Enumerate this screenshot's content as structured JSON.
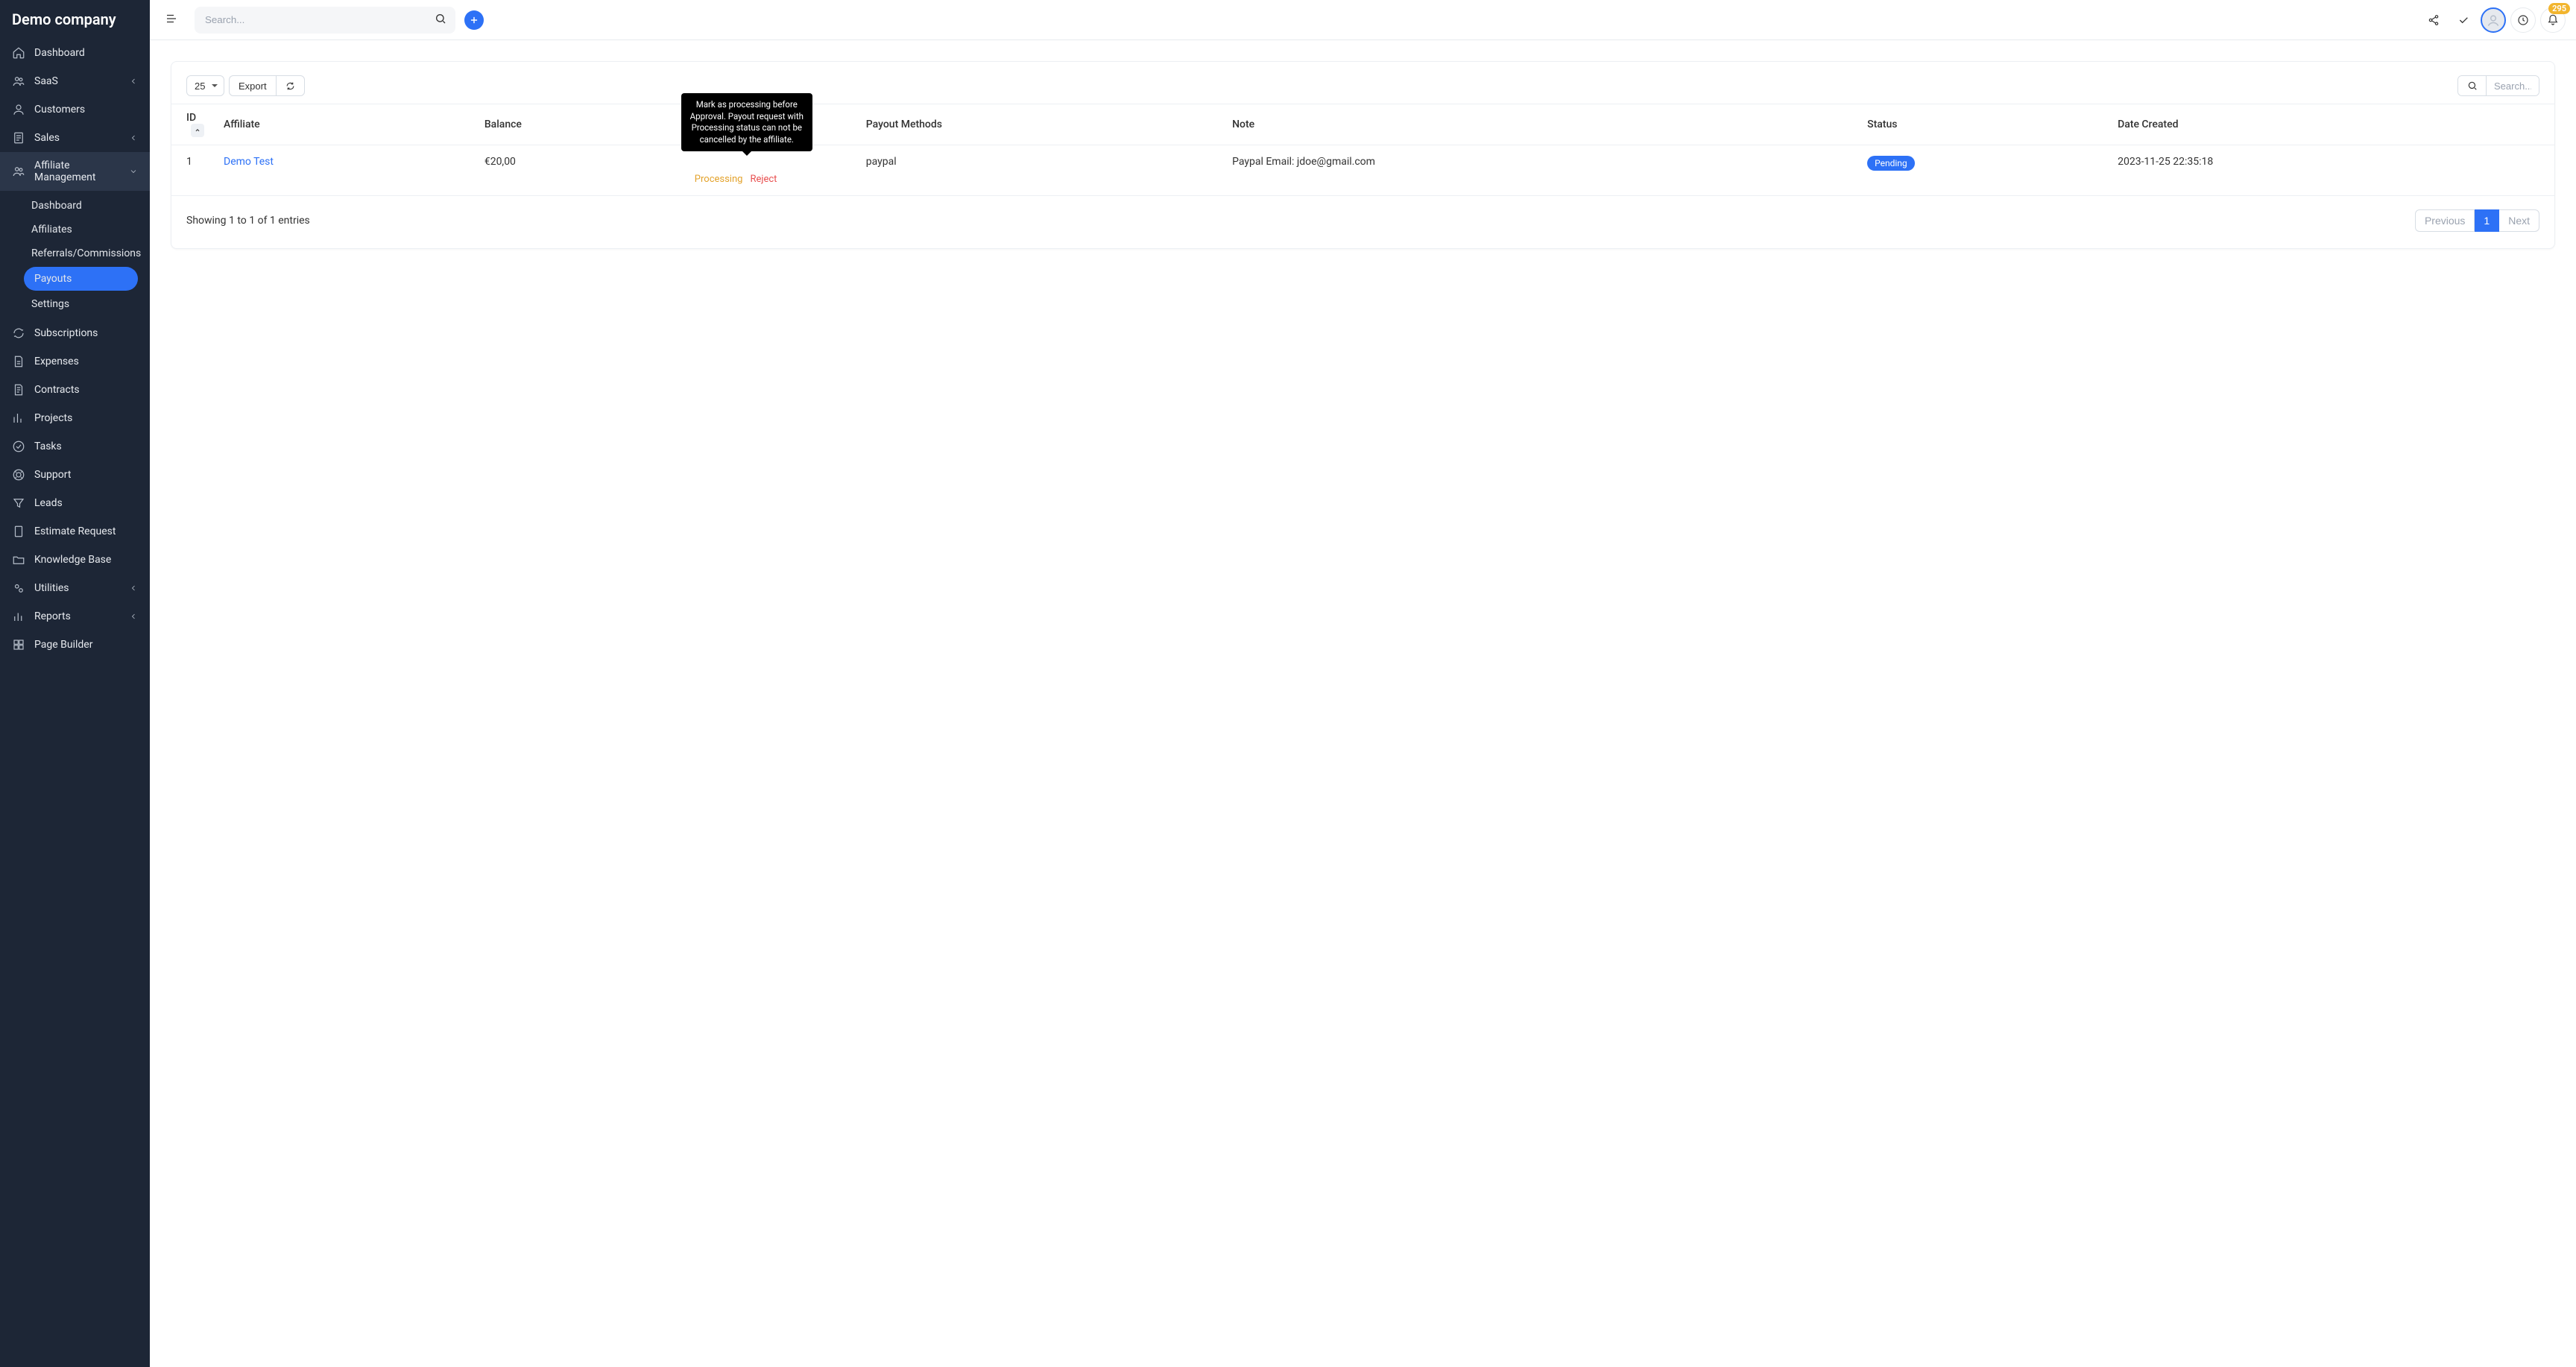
{
  "brand": "Demo company",
  "sidebar": {
    "items": [
      {
        "label": "Dashboard"
      },
      {
        "label": "SaaS",
        "expandable": true
      },
      {
        "label": "Customers"
      },
      {
        "label": "Sales",
        "expandable": true
      },
      {
        "label": "Affiliate Management",
        "expandable": true,
        "active": true
      },
      {
        "label": "Subscriptions"
      },
      {
        "label": "Expenses"
      },
      {
        "label": "Contracts"
      },
      {
        "label": "Projects"
      },
      {
        "label": "Tasks"
      },
      {
        "label": "Support"
      },
      {
        "label": "Leads"
      },
      {
        "label": "Estimate Request"
      },
      {
        "label": "Knowledge Base"
      },
      {
        "label": "Utilities",
        "expandable": true
      },
      {
        "label": "Reports",
        "expandable": true
      },
      {
        "label": "Page Builder"
      }
    ],
    "affiliate_sub": [
      {
        "label": "Dashboard"
      },
      {
        "label": "Affiliates"
      },
      {
        "label": "Referrals/Commissions"
      },
      {
        "label": "Payouts",
        "active": true
      },
      {
        "label": "Settings"
      }
    ]
  },
  "topbar": {
    "search_placeholder": "Search...",
    "notification_count": "295"
  },
  "table": {
    "page_size": "25",
    "export_label": "Export",
    "search_placeholder": "Search...",
    "columns": [
      "ID",
      "Affiliate",
      "Balance",
      "",
      "Payout Methods",
      "Note",
      "Status",
      "Date Created"
    ],
    "rows": [
      {
        "id": "1",
        "affiliate": "Demo Test",
        "balance": "€20,00",
        "payout_methods": "paypal",
        "note": "Paypal Email: jdoe@gmail.com",
        "status": "Pending",
        "date_created": "2023-11-25 22:35:18"
      }
    ],
    "row_actions": {
      "processing": "Processing",
      "reject": "Reject",
      "tooltip": "Mark as processing before Approval. Payout request with Processing status can not be cancelled by the affiliate."
    },
    "footer_text": "Showing 1 to 1 of 1 entries",
    "pager": {
      "previous": "Previous",
      "current": "1",
      "next": "Next"
    }
  }
}
